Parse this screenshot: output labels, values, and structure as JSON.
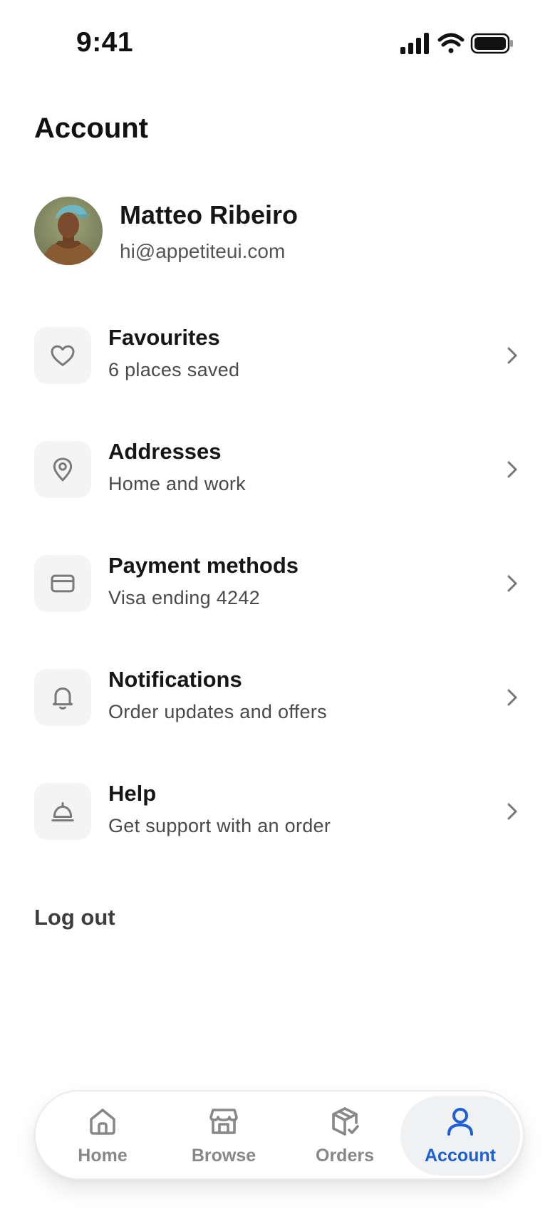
{
  "status_bar": {
    "time": "9:41",
    "icons": [
      "signal-icon",
      "wifi-icon",
      "battery-icon"
    ]
  },
  "page": {
    "title": "Account"
  },
  "profile": {
    "name": "Matteo Ribeiro",
    "email": "hi@appetiteui.com"
  },
  "menu": {
    "items": [
      {
        "icon": "heart-icon",
        "title": "Favourites",
        "subtitle": "6 places saved"
      },
      {
        "icon": "location-pin-icon",
        "title": "Addresses",
        "subtitle": "Home and work"
      },
      {
        "icon": "credit-card-icon",
        "title": "Payment methods",
        "subtitle": "Visa ending 4242"
      },
      {
        "icon": "bell-icon",
        "title": "Notifications",
        "subtitle": "Order updates and offers"
      },
      {
        "icon": "service-bell-icon",
        "title": "Help",
        "subtitle": "Get support with an order"
      }
    ]
  },
  "logout_label": "Log out",
  "tabbar": {
    "active": "Account",
    "tabs": [
      {
        "icon": "home-icon",
        "label": "Home"
      },
      {
        "icon": "store-icon",
        "label": "Browse"
      },
      {
        "icon": "package-icon",
        "label": "Orders"
      },
      {
        "icon": "user-icon",
        "label": "Account"
      }
    ]
  },
  "colors": {
    "accent": "#1f5fd6",
    "text_primary": "#161616",
    "text_secondary": "#4a4a4a",
    "icon_box_bg": "#f4f4f4",
    "tab_inactive": "#888888"
  }
}
